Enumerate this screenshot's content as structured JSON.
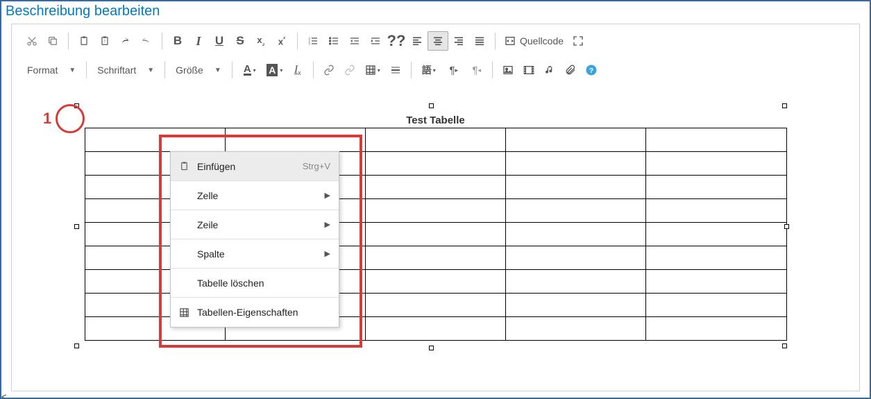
{
  "header": {
    "title": "Beschreibung bearbeiten"
  },
  "toolbar": {
    "source": "Quellcode",
    "format": "Format",
    "font": "Schriftart",
    "size": "Größe"
  },
  "content": {
    "table_title": "Test Tabelle",
    "rows": 9,
    "cols": 5
  },
  "context_menu": [
    {
      "label": "Einfügen",
      "shortcut": "Strg+V"
    },
    {
      "label": "Zelle",
      "submenu": true
    },
    {
      "label": "Zeile",
      "submenu": true
    },
    {
      "label": "Spalte",
      "submenu": true
    },
    {
      "label": "Tabelle löschen"
    },
    {
      "label": "Tabellen-Eigenschaften"
    }
  ],
  "annotations": {
    "number": "1",
    "color": "#d83a3a"
  }
}
